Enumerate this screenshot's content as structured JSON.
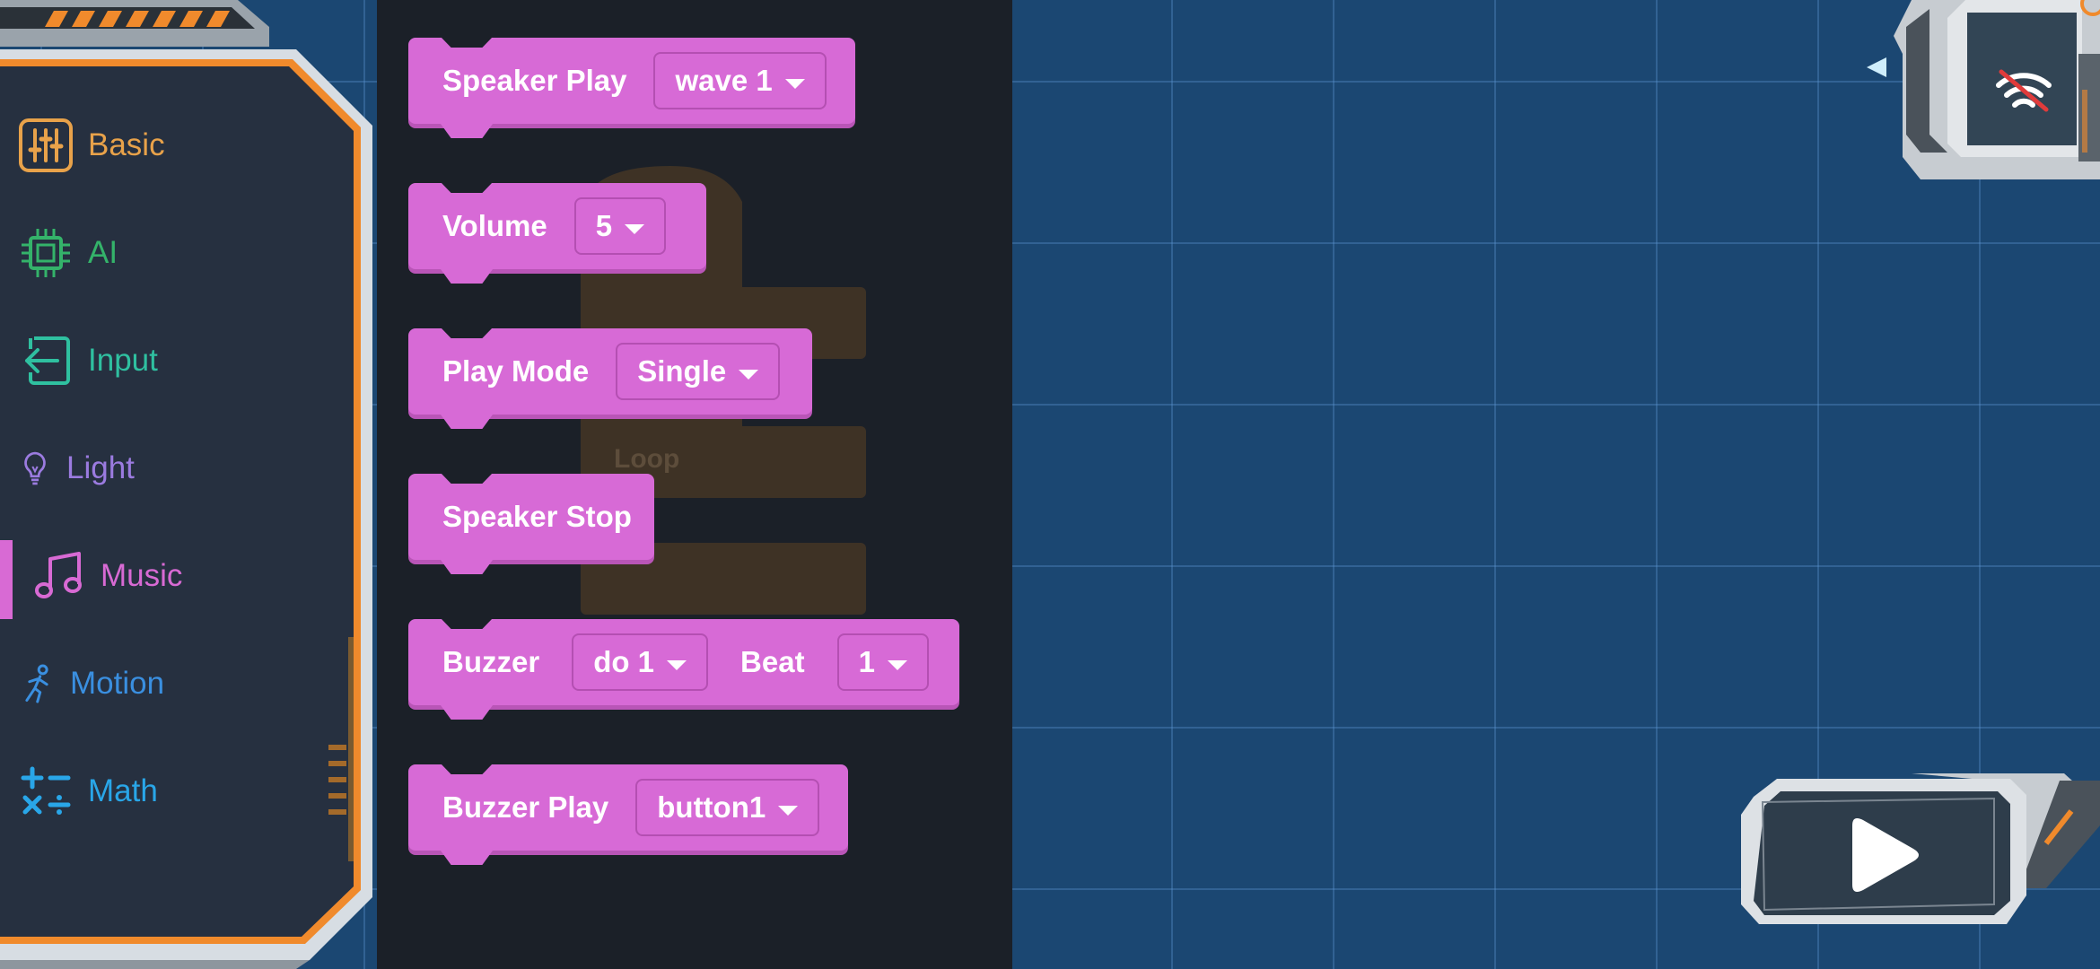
{
  "categories": [
    {
      "label": "Basic",
      "icon": "sliders-icon",
      "color": "#e8a24a"
    },
    {
      "label": "AI",
      "icon": "chip-icon",
      "color": "#34b36a"
    },
    {
      "label": "Input",
      "icon": "input-arrow-icon",
      "color": "#2fc0a0"
    },
    {
      "label": "Light",
      "icon": "lightbulb-icon",
      "color": "#9b7be0"
    },
    {
      "label": "Music",
      "icon": "music-note-icon",
      "color": "#d86ad4"
    },
    {
      "label": "Motion",
      "icon": "runner-icon",
      "color": "#3a8fe0"
    },
    {
      "label": "Math",
      "icon": "math-ops-icon",
      "color": "#29a6e8"
    }
  ],
  "selected_category": "Music",
  "blocks": {
    "speaker_play": {
      "label": "Speaker Play",
      "value": "wave 1"
    },
    "volume": {
      "label": "Volume",
      "value": "5"
    },
    "play_mode": {
      "label": "Play Mode",
      "value": "Single"
    },
    "speaker_stop": {
      "label": "Speaker Stop"
    },
    "buzzer": {
      "label": "Buzzer",
      "note": "do 1",
      "beat_label": "Beat",
      "beat": "1"
    },
    "buzzer_play": {
      "label": "Buzzer Play",
      "value": "button1"
    }
  },
  "ghost_labels": [
    "Loop"
  ],
  "colors": {
    "block": "#d76ad6",
    "flyout_bg": "#1b2028",
    "workspace_bg": "#1b4772",
    "frame_orange": "#f08a2c"
  }
}
